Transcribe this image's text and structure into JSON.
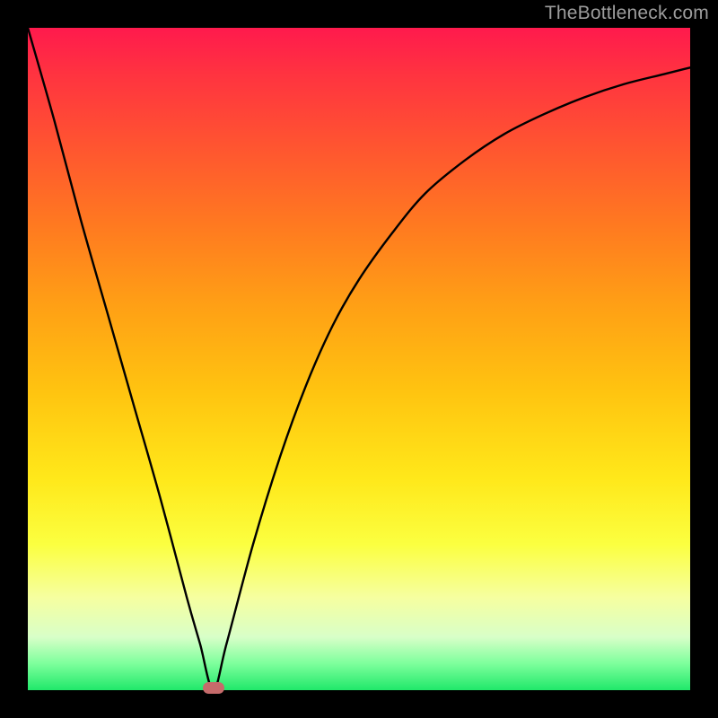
{
  "watermark": "TheBottleneck.com",
  "chart_data": {
    "type": "line",
    "title": "",
    "xlabel": "",
    "ylabel": "",
    "xlim": [
      0,
      100
    ],
    "ylim": [
      0,
      100
    ],
    "series": [
      {
        "name": "bottleneck-curve",
        "x": [
          0,
          4,
          8,
          12,
          16,
          20,
          24,
          26,
          28,
          30,
          34,
          38,
          42,
          46,
          50,
          55,
          60,
          66,
          72,
          78,
          84,
          90,
          96,
          100
        ],
        "y": [
          100,
          86,
          71,
          57,
          43,
          29,
          14,
          7,
          0,
          7,
          22,
          35,
          46,
          55,
          62,
          69,
          75,
          80,
          84,
          87,
          89.5,
          91.5,
          93,
          94
        ]
      }
    ],
    "marker": {
      "x": 28,
      "y": 0,
      "color": "#c66b6b"
    },
    "background_gradient": {
      "top": "#ff1a4d",
      "mid": "#ffe81a",
      "bottom": "#20e86a"
    }
  },
  "layout": {
    "image_size": 800,
    "frame_margin": 31,
    "plot_size": 738
  }
}
